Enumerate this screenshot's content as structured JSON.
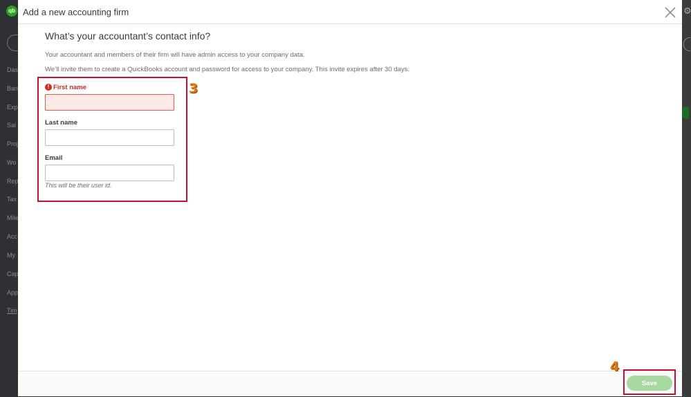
{
  "background_app": {
    "logo_text": "qb",
    "nav_items": [
      "Das",
      "Ban",
      "Exp",
      "Sal",
      "Proj",
      "Wo",
      "Rep",
      "Tax",
      "Mile",
      "Acc",
      "My",
      "Cap",
      "App",
      "Tim"
    ]
  },
  "modal": {
    "title": "Add a new accounting firm",
    "close_icon": "close-icon",
    "heading": "What’s your accountant’s contact info?",
    "description_1": "Your accountant and members of their firm will have admin access to your company data.",
    "description_2": "We’ll invite them to create a QuickBooks account and password for access to your company. This invite expires after 30 days.",
    "fields": {
      "first_name": {
        "label": "First name",
        "value": "",
        "state": "error"
      },
      "last_name": {
        "label": "Last name",
        "value": ""
      },
      "email": {
        "label": "Email",
        "value": "",
        "hint": "This will be their user id."
      }
    },
    "footer": {
      "save_label": "Save"
    }
  },
  "annotations": {
    "step_3": "3",
    "step_4": "4"
  },
  "colors": {
    "error": "#d52b1e",
    "highlight": "#c8102e",
    "step_number": "#e07a12",
    "save_disabled": "#a7d9a0",
    "brand_green": "#2ca01c"
  }
}
